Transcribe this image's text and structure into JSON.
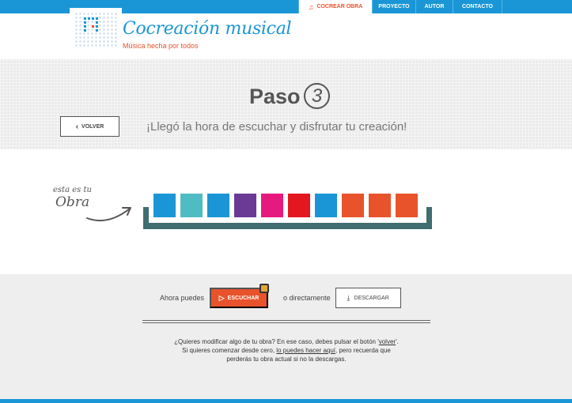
{
  "nav": {
    "items": [
      {
        "label": "COCREAR OBRA",
        "active": true
      },
      {
        "label": "PROYECTO"
      },
      {
        "label": "AUTOR"
      },
      {
        "label": "CONTACTO"
      }
    ]
  },
  "header": {
    "title": "Cocreación musical",
    "subtitle": "Música hecha por todos"
  },
  "step": {
    "title": "Paso",
    "number": "3",
    "message": "¡Llegó la hora de escuchar y disfrutar tu creación!",
    "back_label": "VOLVER"
  },
  "work": {
    "label_line1": "esta es tu",
    "label_line2": "Obra",
    "blocks": [
      "#1a96d6",
      "#4fbcc4",
      "#1a96d6",
      "#6a3a95",
      "#e6197e",
      "#e3171f",
      "#1a96d6",
      "#e8532b",
      "#e8532b",
      "#e8532b"
    ]
  },
  "actions": {
    "now_label": "Ahora puedes",
    "listen_label": "ESCUCHAR",
    "or_label": "o directamente",
    "download_label": "DESCARGAR"
  },
  "help": {
    "line1_a": "¿Quieres modificar algo de tu obra? En ese caso, debes pulsar el botón '",
    "line1_link": "volver",
    "line1_b": "'.",
    "line2_a": "Si quieres comenzar desde cero, ",
    "line2_link": "lo puedes hacer aquí",
    "line2_b": ", pero recuerda que",
    "line3": "perderás tu obra actual si no la descargas."
  },
  "colors": {
    "brand_blue": "#1a96d6",
    "accent_orange": "#e8532b",
    "tray_teal": "#3f6d70"
  }
}
